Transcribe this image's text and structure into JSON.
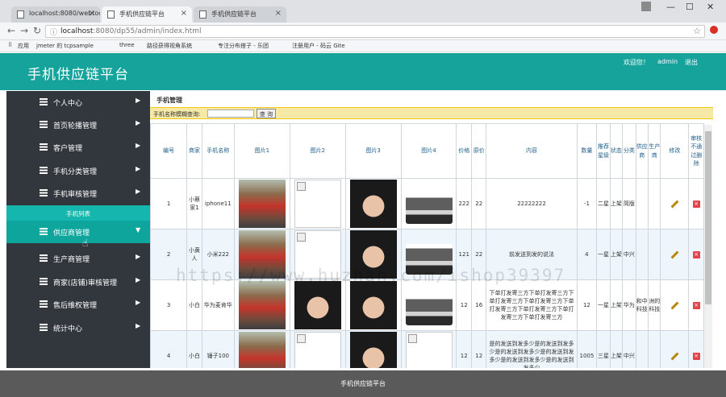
{
  "browser": {
    "tabs": [
      {
        "label": "localhost:8080/webtoo"
      },
      {
        "label": "手机供应链平台"
      },
      {
        "label": "手机供应链平台"
      }
    ],
    "url_prefix": "localhost",
    "url_rest": ":8080/dp55/admin/index.html",
    "bookmarks": [
      "应用",
      "jmeter 的 tcpsample",
      "three",
      "路径获得视角系统",
      "专注分布搭子 - 乐团",
      "注册用户 - 码云 Gite"
    ]
  },
  "header": {
    "brand": "手机供应链平台",
    "welcome": "欢迎您！",
    "user": "admin",
    "logout": "退出"
  },
  "sidebar": {
    "items": [
      {
        "label": "个人中心"
      },
      {
        "label": "首页轮播管理"
      },
      {
        "label": "客户管理"
      },
      {
        "label": "手机分类管理"
      },
      {
        "label": "手机审核管理"
      },
      {
        "label": "供应商管理"
      },
      {
        "label": "生产商管理"
      },
      {
        "label": "商家(店铺)审核管理"
      },
      {
        "label": "售后维权管理"
      },
      {
        "label": "统计中心"
      }
    ],
    "sub_item": "手机列表"
  },
  "main": {
    "title": "手机管理",
    "search_label": "手机名称模糊查询:",
    "search_value": "",
    "search_button": "查 询",
    "columns": [
      "编号",
      "商家",
      "手机名称",
      "图片1",
      "图片2",
      "图片3",
      "图片4",
      "价格",
      "原价",
      "内容",
      "数量",
      "推荐星级",
      "状态",
      "分类",
      "供应商",
      "生产商",
      "修改",
      "审核不通过删除"
    ],
    "rows": [
      {
        "id": "1",
        "merchant": "小蔡家1",
        "name": "iphone11",
        "price": "222",
        "orig": "22",
        "content": "22222222",
        "qty": "-1",
        "star": "二星",
        "status": "上架",
        "category": "简版",
        "supplier": "",
        "maker": ""
      },
      {
        "id": "2",
        "merchant": "小黄人",
        "name": "小米222",
        "price": "121",
        "orig": "22",
        "content": "前发送到发的说法",
        "qty": "4",
        "star": "一星",
        "status": "上架",
        "category": "中兴",
        "supplier": "",
        "maker": ""
      },
      {
        "id": "3",
        "merchant": "小白",
        "name": "华为麦肯华",
        "price": "12",
        "orig": "16",
        "content": "下单打发寄三方下单打发寄三方下单打发寄三方下单打发寄三方下单打发寄三方下单打发寄三方下单打发寄三方下单打发寄三方",
        "qty": "12",
        "star": "一星",
        "status": "上架",
        "category": "华为",
        "supplier": "和中科技",
        "maker": "洲的科技"
      },
      {
        "id": "4",
        "merchant": "小白",
        "name": "锤子100",
        "price": "12",
        "orig": "12",
        "content": "是的发送到发多少是的发送到发多少是的发送到发多少是的发送到发多少是的发送到发多少是的发送到发多少",
        "qty": "1005",
        "star": "三星",
        "status": "上架",
        "category": "中兴",
        "supplier": "",
        "maker": ""
      }
    ]
  },
  "footer": {
    "text": "手机供应链平台"
  },
  "watermark": "https://www.huzhan.com/ishop39397"
}
